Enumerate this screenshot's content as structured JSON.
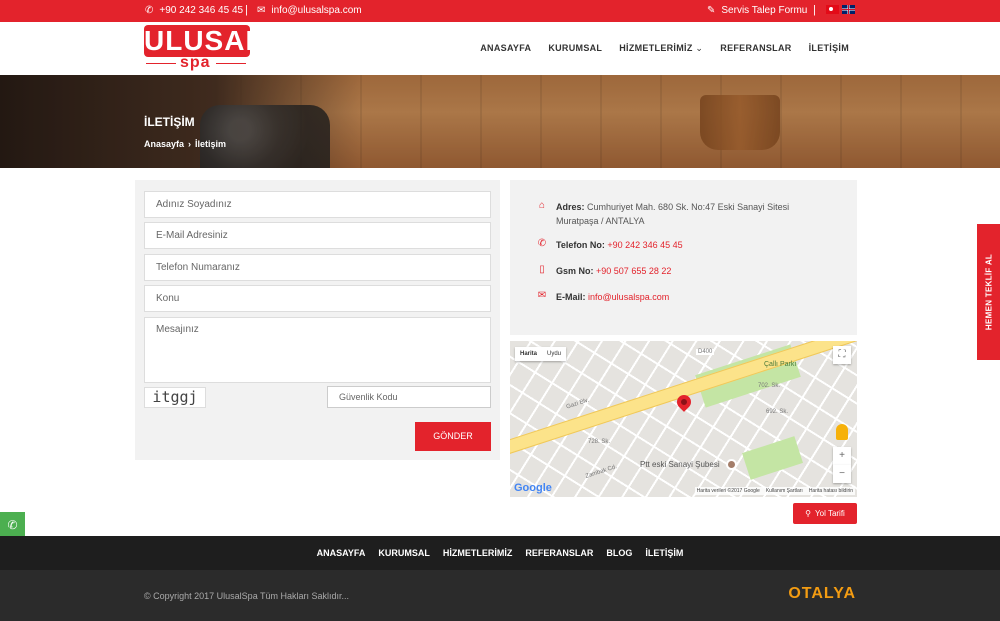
{
  "topbar": {
    "phone": "+90 242 346 45 45",
    "email": "info@ulusalspa.com",
    "separator": "|",
    "service_form": "Servis Talep Formu"
  },
  "header": {
    "logo_main": "ULUSAL",
    "logo_sub": "spa",
    "nav": [
      "ANASAYFA",
      "KURUMSAL",
      "HİZMETLERİMİZ",
      "REFERANSLAR",
      "İLETİŞİM"
    ]
  },
  "hero": {
    "title": "İLETİŞİM",
    "breadcrumb_home": "Anasayfa",
    "breadcrumb_sep": "›",
    "breadcrumb_current": "İletişim"
  },
  "form": {
    "name_placeholder": "Adınız Soyadınız",
    "email_placeholder": "E-Mail Adresiniz",
    "phone_placeholder": "Telefon Numaranız",
    "subject_placeholder": "Konu",
    "message_placeholder": "Mesajınız",
    "captcha_text": "itggj",
    "captcha_placeholder": "Güvenlik Kodu",
    "submit_label": "GÖNDER"
  },
  "contact": {
    "address_label": "Adres:",
    "address_line1": "Cumhuriyet Mah. 680 Sk. No:47 Eski Sanayi Sitesi",
    "address_line2": "Muratpaşa / ANTALYA",
    "phone_label": "Telefon No:",
    "phone_value": "+90 242 346 45 45",
    "gsm_label": "Gsm No:",
    "gsm_value": "+90 507 655 28 22",
    "email_label": "E-Mail:",
    "email_value": "info@ulusalspa.com"
  },
  "map": {
    "type_map": "Harita",
    "type_satellite": "Uydu",
    "poi_label": "Ptt eski Sanayi Şubesi",
    "park_label": "Çallı Parkı",
    "street_gazi": "Gazi Blv.",
    "street_zambak": "Zambak Cd.",
    "street_702": "702. Sk.",
    "street_692": "692. Sk.",
    "street_728": "728. Sk.",
    "road_code": "D400",
    "attribution_data": "Harita verileri ©2017 Google",
    "attribution_terms": "Kullanım Şartları",
    "attribution_report": "Harita hatası bildirin",
    "google": "Google",
    "zoom_in": "+",
    "zoom_out": "−",
    "fullscreen": "⛶"
  },
  "directions_label": "Yol Tarifi",
  "side_tab": "HEMEN TEKLİF AL",
  "social": [
    {
      "icon": "phone-icon",
      "color": "#4caf50",
      "glyph": "✆"
    },
    {
      "icon": "envelope-icon",
      "color": "#e3232c",
      "glyph": "✉"
    },
    {
      "icon": "map-marker-icon",
      "color": "#555555",
      "glyph": "⚲"
    },
    {
      "icon": "facebook-icon",
      "color": "#3b5998",
      "glyph": "f"
    }
  ],
  "footer": {
    "nav": [
      "ANASAYFA",
      "KURUMSAL",
      "HİZMETLERİMİZ",
      "REFERANSLAR",
      "BLOG",
      "İLETİŞİM"
    ],
    "copyright": "© Copyright 2017 UlusalSpa Tüm Hakları Saklıdır...",
    "brand": "OTALYA"
  },
  "colors": {
    "brand_red": "#e3232c",
    "footer_dark": "#1e1e1e",
    "footer_bottom": "#2b2b2b"
  }
}
